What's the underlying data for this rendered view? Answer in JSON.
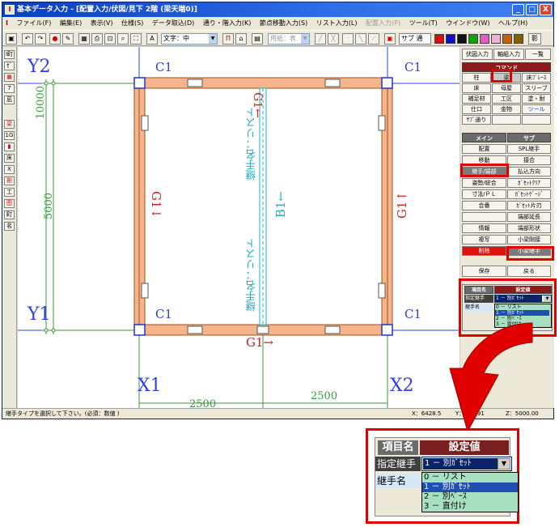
{
  "window": {
    "title": "基本データ入力 - [配置入力/伏図/見下 2階 (梁天端0)]",
    "app_icon": "I",
    "controls": [
      "_",
      "□",
      "X"
    ]
  },
  "menu": [
    "ファイル(F)",
    "編集(E)",
    "表示(V)",
    "仕様(S)",
    "データ取込(D)",
    "通り・階入力(K)",
    "節点移動入力(S)",
    "リスト入力(L)",
    "配置入力(P)",
    "ツール(T)",
    "ウインドウ(W)",
    "ヘルプ(H)"
  ],
  "toolbar": {
    "text_size": "文字：中",
    "paper_label": "用紙：表",
    "sub_label": "サブ 通",
    "shadow_label": "影",
    "colors": [
      "#d01010",
      "#1010c0",
      "#101010",
      "#10a010",
      "#e060c0",
      "#f0b0d0",
      "#c06010",
      "#806000"
    ]
  },
  "left_tools": [
    "I町",
    "ｾﾞ",
    "▦",
    "7階",
    "凪",
    "梁",
    "1G",
    "▮",
    "床",
    "X",
    "剖",
    "工",
    "图",
    "町",
    "名"
  ],
  "canvas": {
    "grid_labels": {
      "y2": "Y2",
      "y1": "Y1",
      "x1": "X1",
      "x2": "X2"
    },
    "column_labels": {
      "tl": "C1",
      "tr": "C1",
      "bl": "C1",
      "br": "C1"
    },
    "dims": {
      "h_total": "10000",
      "h_half": "5000",
      "bottom_left": "2500",
      "bottom_right": "2500"
    },
    "beams": {
      "top": "G1←",
      "bottom": "G1→",
      "left": "G1↓",
      "right": "G1↑",
      "middle": "B1←",
      "joint_top": "継手名：リスト",
      "joint_bottom": "継手名：リスト"
    }
  },
  "right_panel": {
    "tabs": [
      "伏図入力",
      "軸組入力",
      "一覧"
    ],
    "command_header": "コマンド",
    "command_rows": [
      [
        "柱",
        "梁",
        "床ﾌﾞﾚｰｽ"
      ],
      [
        "床",
        "母屋",
        "スリーブ"
      ],
      [
        "補足材",
        "工区",
        "塗・耐"
      ],
      [
        "仕口",
        "金物",
        "ツール"
      ],
      [
        "ｻﾌﾞ通り",
        "",
        ""
      ]
    ],
    "main_header": "メイン",
    "sub_header": "サブ",
    "main_items": [
      "配置",
      "移動",
      "継手/端部",
      "姿勢/総合",
      "寸法/ＰＬ",
      "合番",
      "",
      "情報",
      "複写",
      "削除"
    ],
    "sub_items": [
      "SPL継手",
      "接合",
      "払込方向",
      "ｶﾞｾｯﾄｸﾘｱ",
      "ｶﾞｾｯﾄｹﾞｰｼﾞ",
      "ｶﾞｾｯﾄ片刃",
      "端部延長",
      "端部形状",
      "小梁剛接",
      "小梁継手"
    ],
    "save": "保存",
    "back": "戻る",
    "prop_header_name": "項目名",
    "prop_header_value": "設定値",
    "prop_row1": "指定継手",
    "prop_row1_value": "1 － 別ｶﾞｾｯﾄ",
    "prop_row2": "継手名",
    "options": [
      "0 － リスト",
      "1 － 別ｶﾞｾｯﾄ",
      "2 － 別ﾍﾞｰｽ",
      "3 － 直付け"
    ]
  },
  "status": {
    "message": "継手タイプを選択して下さい。(必須：数値 )",
    "x": "X：6428.5",
    "y": "Y：309.91",
    "z": "Z：5000.00"
  },
  "zoom": {
    "header_name": "項目名",
    "header_value": "設定値",
    "row1": "指定継手",
    "row1_value": "1 － 別ｶﾞｾｯﾄ",
    "row2": "継手名",
    "options": [
      "0 － リスト",
      "1 － 別ｶﾞｾｯﾄ",
      "2 － 別ﾍﾞｰｽ",
      "3 － 直付け"
    ]
  },
  "colors": {
    "beam": "#f5b48a",
    "grid_blue": "#3040e0",
    "dim_green": "#3a9a3a",
    "highlight_red": "#e00000"
  }
}
